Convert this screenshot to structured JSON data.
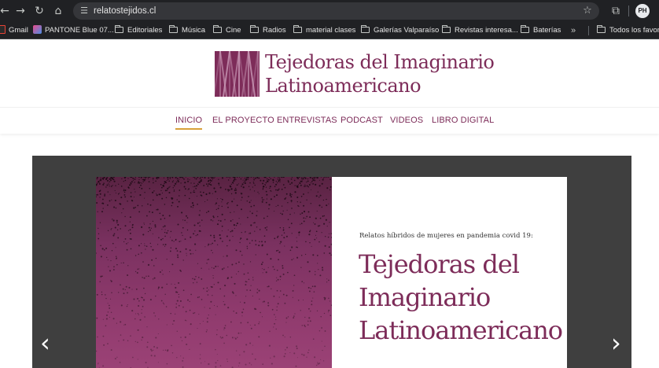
{
  "browser": {
    "url": "relatostejidos.cl",
    "nav_icons": {
      "back": "←",
      "forward": "→",
      "reload": "↻",
      "home": "⌂"
    },
    "avatar_label": "PH",
    "bookmarks": [
      {
        "label": "Gmail",
        "icon": "gmail-icon",
        "color": "#ea4335"
      },
      {
        "label": "PANTONE Blue 07...",
        "icon": "pantone-icon",
        "color": "#e94b8a"
      },
      {
        "label": "Editoriales",
        "icon": "folder-icon"
      },
      {
        "label": "Música",
        "icon": "folder-icon"
      },
      {
        "label": "Cine",
        "icon": "folder-icon"
      },
      {
        "label": "Radios",
        "icon": "folder-icon"
      },
      {
        "label": "material clases",
        "icon": "folder-icon"
      },
      {
        "label": "Galerías Valparaíso",
        "icon": "folder-icon"
      },
      {
        "label": "Revistas interesa...",
        "icon": "folder-icon"
      },
      {
        "label": "Baterías",
        "icon": "folder-icon"
      }
    ],
    "more_bookmarks": "»",
    "all_bookmarks": "Todos los favorit"
  },
  "site": {
    "logo_line1": "Tejedoras del Imaginario",
    "logo_line2": "Latinoamericano",
    "brand_color": "#7d2c59",
    "accent_color": "#d8a13a",
    "nav": [
      {
        "label": "INICIO",
        "active": true
      },
      {
        "label": "EL PROYECTO"
      },
      {
        "label": "ENTREVISTAS"
      },
      {
        "label": "PODCAST"
      },
      {
        "label": "VIDEOS"
      },
      {
        "label": "LIBRO DIGITAL"
      }
    ]
  },
  "hero": {
    "subtitle": "Relatos híbridos de mujeres en pandemia covid 19:",
    "title_line1": "Tejedoras del",
    "title_line2": "Imaginario",
    "title_line3": "Latinoamericano",
    "prev_icon": "‹",
    "next_icon": "›"
  }
}
